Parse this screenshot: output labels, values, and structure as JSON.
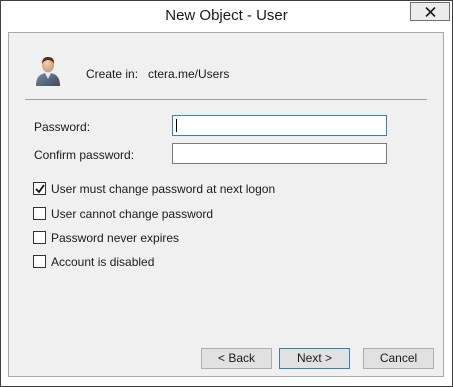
{
  "window": {
    "title": "New Object - User"
  },
  "header": {
    "create_in_label": "Create in:",
    "create_in_path": "ctera.me/Users",
    "icon": "user-icon"
  },
  "fields": {
    "password_label": "Password:",
    "password_value": "",
    "confirm_label": "Confirm password:",
    "confirm_value": ""
  },
  "options": [
    {
      "label": "User must change password at next logon",
      "checked": true
    },
    {
      "label": "User cannot change password",
      "checked": false
    },
    {
      "label": "Password never expires",
      "checked": false
    },
    {
      "label": "Account is disabled",
      "checked": false
    }
  ],
  "buttons": {
    "back_label": "< Back",
    "next_label": "Next >",
    "cancel_label": "Cancel"
  },
  "colors": {
    "focus_border": "#3c7fb1",
    "dialog_bg": "#f0f0f0"
  }
}
